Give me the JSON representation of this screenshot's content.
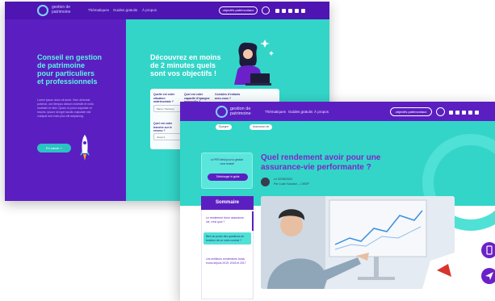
{
  "back": {
    "logo_line1": "gestion de",
    "logo_line2": "patrimoine",
    "nav": [
      "Thématiques",
      "Guides gratuits",
      "À propos"
    ],
    "cta_pill": "objectifs patrimoniaux",
    "hero_title": "Conseil en gestion de patrimoine pour particuliers et professionnels",
    "hero_paragraph": "Lorem ipsum dolor sit amet. Sem dictumst pulvinar, orci tempus dictum molestie et nulla molestie et nibh. Quam ut proin vulputate et mauris. Ipsum sit eget iaculis vulputate nisl volutpat sed enim plus elit adipiscing.",
    "hero_button": "En savoir +",
    "discover_title": "Découvrez en moins de 2 minutes quels sont vos objectifs !",
    "questions": [
      {
        "label": "Quelle est votre situation matrimoniale ?",
        "value": "Marié / Pacsé(e)"
      },
      {
        "label": "Quel est votre capacité d'épargne mensuelle ?",
        "value": ""
      },
      {
        "label": "Combien d'enfants avez-vous ?",
        "value": ""
      },
      {
        "label": "Quel est votre tranche sur le revenu ?",
        "value": "Jusqu'à"
      }
    ]
  },
  "front": {
    "logo_line1": "gestion de",
    "logo_line2": "patrimoine",
    "nav": [
      "Thématiques",
      "Guides gratuits",
      "À propos"
    ],
    "cta_pill": "objectifs patrimoniaux",
    "breadcrumbs": [
      "Épargne",
      "Assurance-vie"
    ],
    "promo_text": "Le PER idéal pour la gestion vous rendait",
    "promo_button": "Télécharger le guide",
    "article_title": "Quel rendement avoir pour une assurance-vie performante ?",
    "date": "Le 02/08/2022",
    "author": "Par Lucie Sauvion – CIESP",
    "summary_title": "Sommaire",
    "summary_items": [
      "Le rendement d'une assurance-vie, c'est quoi ?",
      "Bien se poser des questions en fonction de ce votre contrat ?",
      "Les meilleurs rendements fonds euros depuis 2019, 2018 et 2017"
    ]
  },
  "colors": {
    "purple": "#5b1fc1",
    "teal": "#33d5c8",
    "accent_text": "#7a28c9"
  }
}
